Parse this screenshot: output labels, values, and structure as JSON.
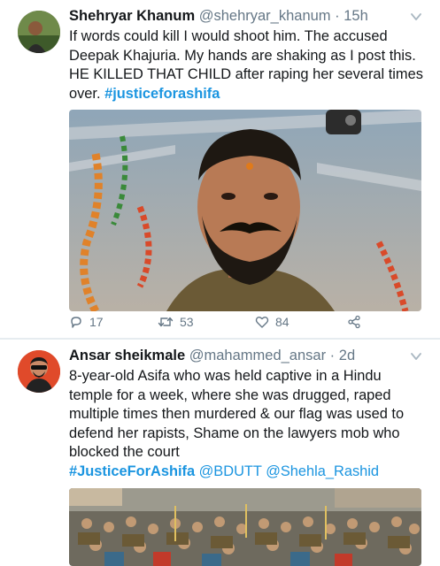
{
  "tweets": [
    {
      "name": "Shehryar Khanum",
      "handle": "@shehryar_khanum",
      "separator": "·",
      "time": "15h",
      "text_lines": [
        "If words could kill I would shoot him. The accused",
        "Deepak Khajuria. My hands are shaking as I post this.",
        "HE KILLED THAT CHILD after raping her several times",
        "over. "
      ],
      "hashtag": "#justiceforashifa",
      "actions": {
        "replies": "17",
        "retweets": "53",
        "likes": "84"
      },
      "icons": {
        "avatar": "profile-avatar",
        "menu": "chevron-down-icon",
        "reply": "reply-icon",
        "retweet": "retweet-icon",
        "like": "heart-icon",
        "share": "share-icon"
      }
    },
    {
      "name": "Ansar sheikmale",
      "handle": "@mahammed_ansar",
      "separator": "·",
      "time": "2d",
      "text_lines": [
        "8-year-old Asifa who was held captive in a Hindu",
        "temple for a week, where she was drugged, raped",
        "multiple times then murdered & our flag was used to",
        "defend her rapists, Shame on the lawyers mob who",
        "blocked the court"
      ],
      "hashtag": "#JusticeForAshifa",
      "mentions": [
        "@BDUTT",
        "@Shehla_Rashid"
      ],
      "icons": {
        "avatar": "profile-avatar",
        "menu": "chevron-down-icon"
      }
    }
  ],
  "colors": {
    "link": "#1b95e0",
    "secondary_text": "#657786",
    "primary_text": "#14171a",
    "separator": "#e6ecf0"
  }
}
